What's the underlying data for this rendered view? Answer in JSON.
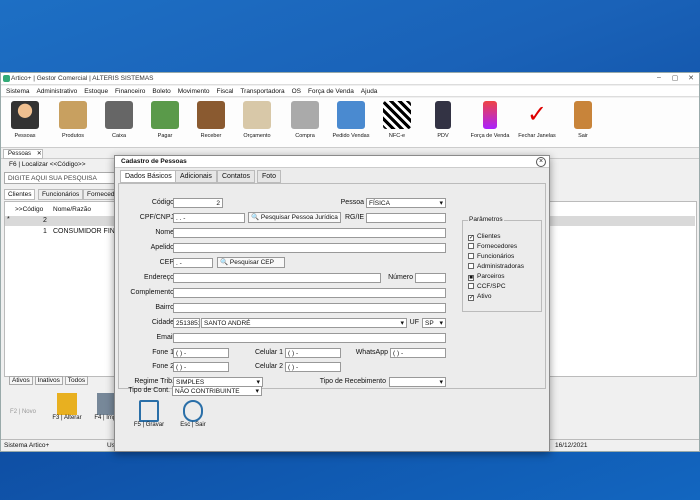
{
  "window": {
    "title": "Artico+ | Gestor Comercial | ALTERIS SISTEMAS",
    "status": "Sistema Artico+",
    "status_user": "Usu",
    "date": "16/12/2021"
  },
  "menu": [
    "Sistema",
    "Administrativo",
    "Estoque",
    "Financeiro",
    "Boleto",
    "Movimento",
    "Fiscal",
    "Transportadora",
    "OS",
    "Força de Venda",
    "Ajuda"
  ],
  "toolbar": [
    "Pessoas",
    "Produtos",
    "Caixa",
    "Pagar",
    "Receber",
    "Orçamento",
    "Compra",
    "Pedido Vendas",
    "NFC-e",
    "PDV",
    "Força de Venda",
    "Fechar Janelas",
    "Sair"
  ],
  "tab": "Pessoas",
  "search": {
    "label": "F6 | Localizar <<Código>>",
    "placeholder": "DIGITE AQUI SUA PESQUISA"
  },
  "subtabs": [
    "Clientes",
    "Funcionários",
    "Fornecedo"
  ],
  "grid": {
    "col1": ">>Código",
    "col2": "Nome/Razão",
    "row1_code": "2",
    "row2_code": "1",
    "row2_name": "CONSUMIDOR FINAL"
  },
  "bottom_tabs": [
    "Ativos",
    "Inativos",
    "Todos"
  ],
  "bottom_btns": [
    "F2 | Novo",
    "F3 | Alterar",
    "F4 | Impri"
  ],
  "dialog": {
    "title": "Cadastro de Pessoas",
    "close": "×",
    "tabs": [
      "Dados Básicos",
      "Adicionais",
      "Contatos",
      "Foto"
    ],
    "labels": {
      "codigo": "Código",
      "pessoa": "Pessoa",
      "cpf": "CPF/CNPJ",
      "rgie": "RG/IE",
      "nome": "Nome",
      "apelido": "Apelido",
      "cep": "CEP",
      "endereco": "Endereço",
      "numero": "Número",
      "complemento": "Complemento",
      "bairro": "Bairro",
      "cidade": "Cidade",
      "uf": "UF",
      "email": "Email",
      "fone1": "Fone 1",
      "fone2": "Fone 2",
      "cel1": "Celular 1",
      "cel2": "Celular 2",
      "whatsapp": "WhatsApp",
      "regime": "Regime Trib.",
      "tiporec": "Tipo de Recebimento",
      "tipocont": "Tipo de Cont."
    },
    "values": {
      "codigo": "2",
      "pessoa": "FÍSICA",
      "cpf": ".   .   -",
      "cep": ".   -",
      "cidade_cod": "2513851",
      "cidade": "SANTO ANDRÉ",
      "uf": "SP",
      "fone1": "(  )     -",
      "fone2": "(  )     -",
      "cel1": "(  )     -",
      "cel2": "(  )     -",
      "whatsapp": "(  )     -",
      "regime": "SIMPLES",
      "tipocont": "NÃO CONTRIBUINTE"
    },
    "buttons": {
      "pesq_juridica": "Pesquisar Pessoa Jurídica",
      "pesq_cep": "Pesquisar CEP",
      "gravar": "F5 | Gravar",
      "sair": "Esc | Sair"
    },
    "params": {
      "title": "Parâmetros",
      "items": [
        "Clientes",
        "Fornecedores",
        "Funcionários",
        "Administradoras",
        "Parceiros",
        "CCF/SPC",
        "Ativo"
      ],
      "checked": [
        true,
        false,
        false,
        false,
        true,
        false,
        true
      ]
    }
  }
}
